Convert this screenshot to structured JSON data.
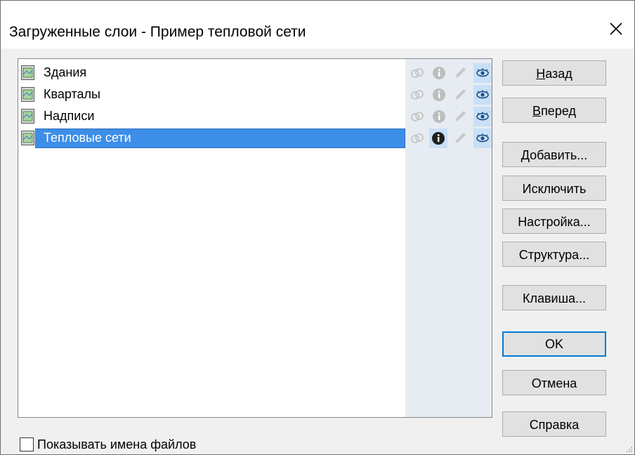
{
  "window": {
    "title": "Загруженные слои - Пример тепловой сети"
  },
  "layers": [
    {
      "name": "Здания",
      "selected": false
    },
    {
      "name": "Кварталы",
      "selected": false
    },
    {
      "name": "Надписи",
      "selected": false
    },
    {
      "name": "Тепловые сети",
      "selected": true
    }
  ],
  "layer_status_icons": [
    "link-icon",
    "info-icon",
    "pencil-icon",
    "eye-icon"
  ],
  "buttons": {
    "back_mnemonic": "Н",
    "back_rest": "азад",
    "forward_mnemonic": "В",
    "forward_rest": "перед",
    "add": "Добавить...",
    "exclude": "Исключить",
    "settings": "Настройка...",
    "structure": "Структура...",
    "key": "Клавиша...",
    "ok": "OK",
    "cancel": "Отмена",
    "help": "Справка"
  },
  "checkbox": {
    "label": "Показывать имена файлов",
    "checked": false
  },
  "colors": {
    "selection": "#3d8ee8",
    "icon_column": "#e6ecf2",
    "active_icon_bg": "#c9dff5",
    "default_button_border": "#0078d7"
  }
}
